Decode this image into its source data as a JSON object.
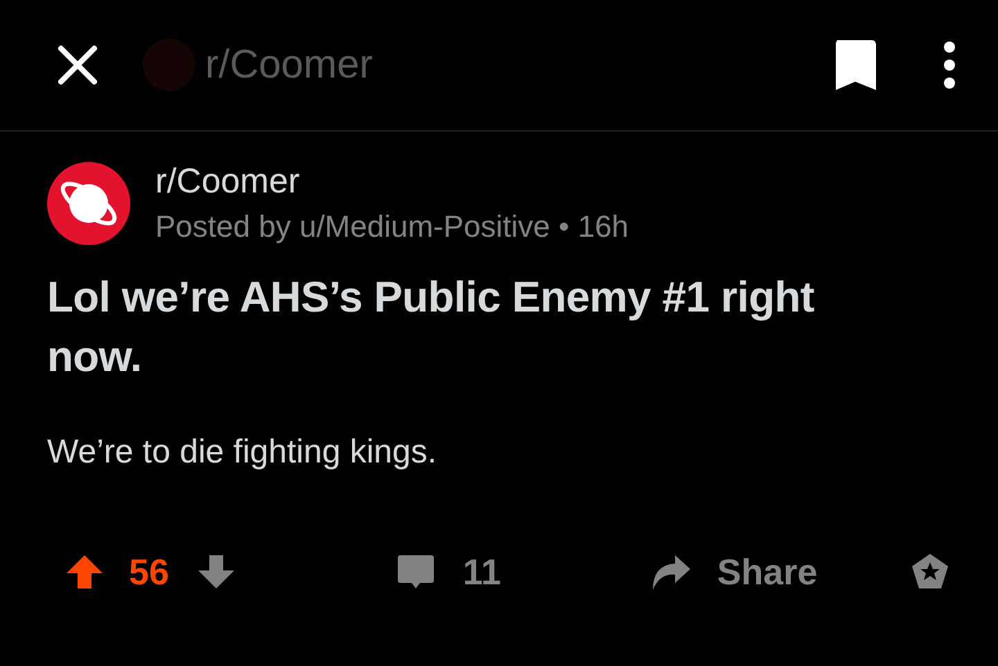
{
  "header": {
    "title": "r/Coomer"
  },
  "post": {
    "subreddit": "r/Coomer",
    "byline": "Posted by u/Medium-Positive",
    "separator": "•",
    "age": "16h",
    "title": "Lol we’re AHS’s Public Enemy #1 right now.",
    "body": "We’re to die fighting kings."
  },
  "actions": {
    "score": "56",
    "upvoted": true,
    "comments": "11",
    "share": "Share"
  }
}
